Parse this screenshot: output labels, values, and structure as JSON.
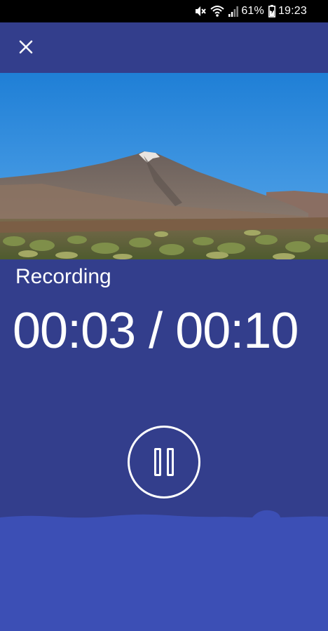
{
  "status_bar": {
    "battery_percent": "61%",
    "time": "19:23",
    "icons": [
      "mute-icon",
      "wifi-icon",
      "signal-icon",
      "battery-icon"
    ]
  },
  "app_bar": {
    "close_icon": "close-icon"
  },
  "photo": {
    "subject": "mountain-landscape-photo"
  },
  "recorder": {
    "state_label": "Recording",
    "elapsed": "00:03",
    "separator": "/",
    "total": "00:10",
    "timer_text": "00:03 / 00:10",
    "control_icon": "pause-icon"
  },
  "colors": {
    "background": "#333e8c",
    "waveform": "#3c4fb5",
    "text": "#ffffff",
    "status_bar": "#000000"
  }
}
